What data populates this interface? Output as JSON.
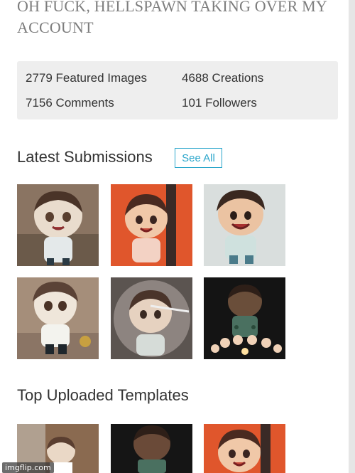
{
  "header": {
    "caption": "OH FUCK, HELLSPAWN TAKING OVER MY ACCOUNT"
  },
  "stats": {
    "featured_images": "2779 Featured Images",
    "creations": "4688 Creations",
    "comments": "7156 Comments",
    "followers": "101 Followers"
  },
  "latest_submissions": {
    "title": "Latest Submissions",
    "see_all": "See All"
  },
  "top_templates": {
    "title": "Top Uploaded Templates"
  },
  "watermark": "imgflip.com",
  "colors": {
    "accent": "#2ba6cb",
    "stats_bg": "#eeeeee",
    "text": "#333333"
  }
}
